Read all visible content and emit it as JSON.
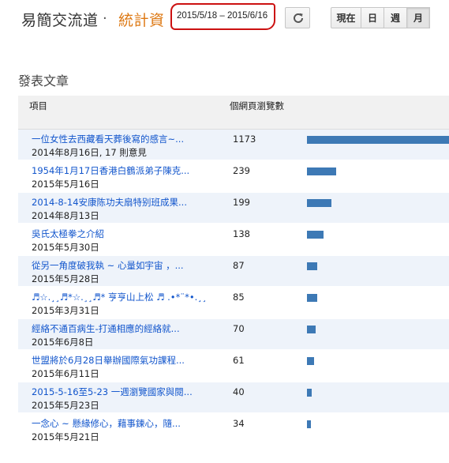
{
  "header": {
    "blog_title": "易簡交流道",
    "separator": "·",
    "stats_title": "統計資",
    "date_range": "2015/5/18 – 2015/6/16",
    "refresh_icon": "refresh-icon",
    "range_buttons": [
      "現在",
      "日",
      "週",
      "月"
    ],
    "active_range": "月"
  },
  "section": {
    "title": "發表文章"
  },
  "table": {
    "col_item": "項目",
    "col_views": "個網頁瀏覽數",
    "max_views": 1173,
    "bar_color": "#3d79b5",
    "rows": [
      {
        "title": "一位女性去西藏看天葬後寫的感言~...",
        "date": "2014年8月16日",
        "comments": "17 則意見",
        "views": 1173
      },
      {
        "title": "1954年1月17日香港白鶴派弟子陳克...",
        "date": "2015年5月16日",
        "comments": "",
        "views": 239
      },
      {
        "title": "2014-8-14安康陈功夫扇特别班成果...",
        "date": "2014年8月13日",
        "comments": "",
        "views": 199
      },
      {
        "title": "吳氏太極拳之介紹",
        "date": "2015年5月30日",
        "comments": "",
        "views": 138
      },
      {
        "title": "從另一角度破我執 ~ 心量如宇宙 ，...",
        "date": "2015年5月28日",
        "comments": "",
        "views": 87
      },
      {
        "title": "♬☆.¸¸♬*☆.¸¸♬* 亨亨山上松 ♬ .•*¨*•.¸¸...",
        "date": "2015年3月31日",
        "comments": "",
        "views": 85
      },
      {
        "title": "經絡不通百病生-打通相應的經絡就...",
        "date": "2015年6月8日",
        "comments": "",
        "views": 70
      },
      {
        "title": "世盟將於6月28日舉辦國際氣功課程...",
        "date": "2015年6月11日",
        "comments": "",
        "views": 61
      },
      {
        "title": "2015-5-16至5-23 一週瀏覽國家與閱...",
        "date": "2015年5月23日",
        "comments": "",
        "views": 40
      },
      {
        "title": "一念心 ~ 懸緣修心，藉事鍊心，隨...",
        "date": "2015年5月21日",
        "comments": "",
        "views": 34
      }
    ]
  }
}
